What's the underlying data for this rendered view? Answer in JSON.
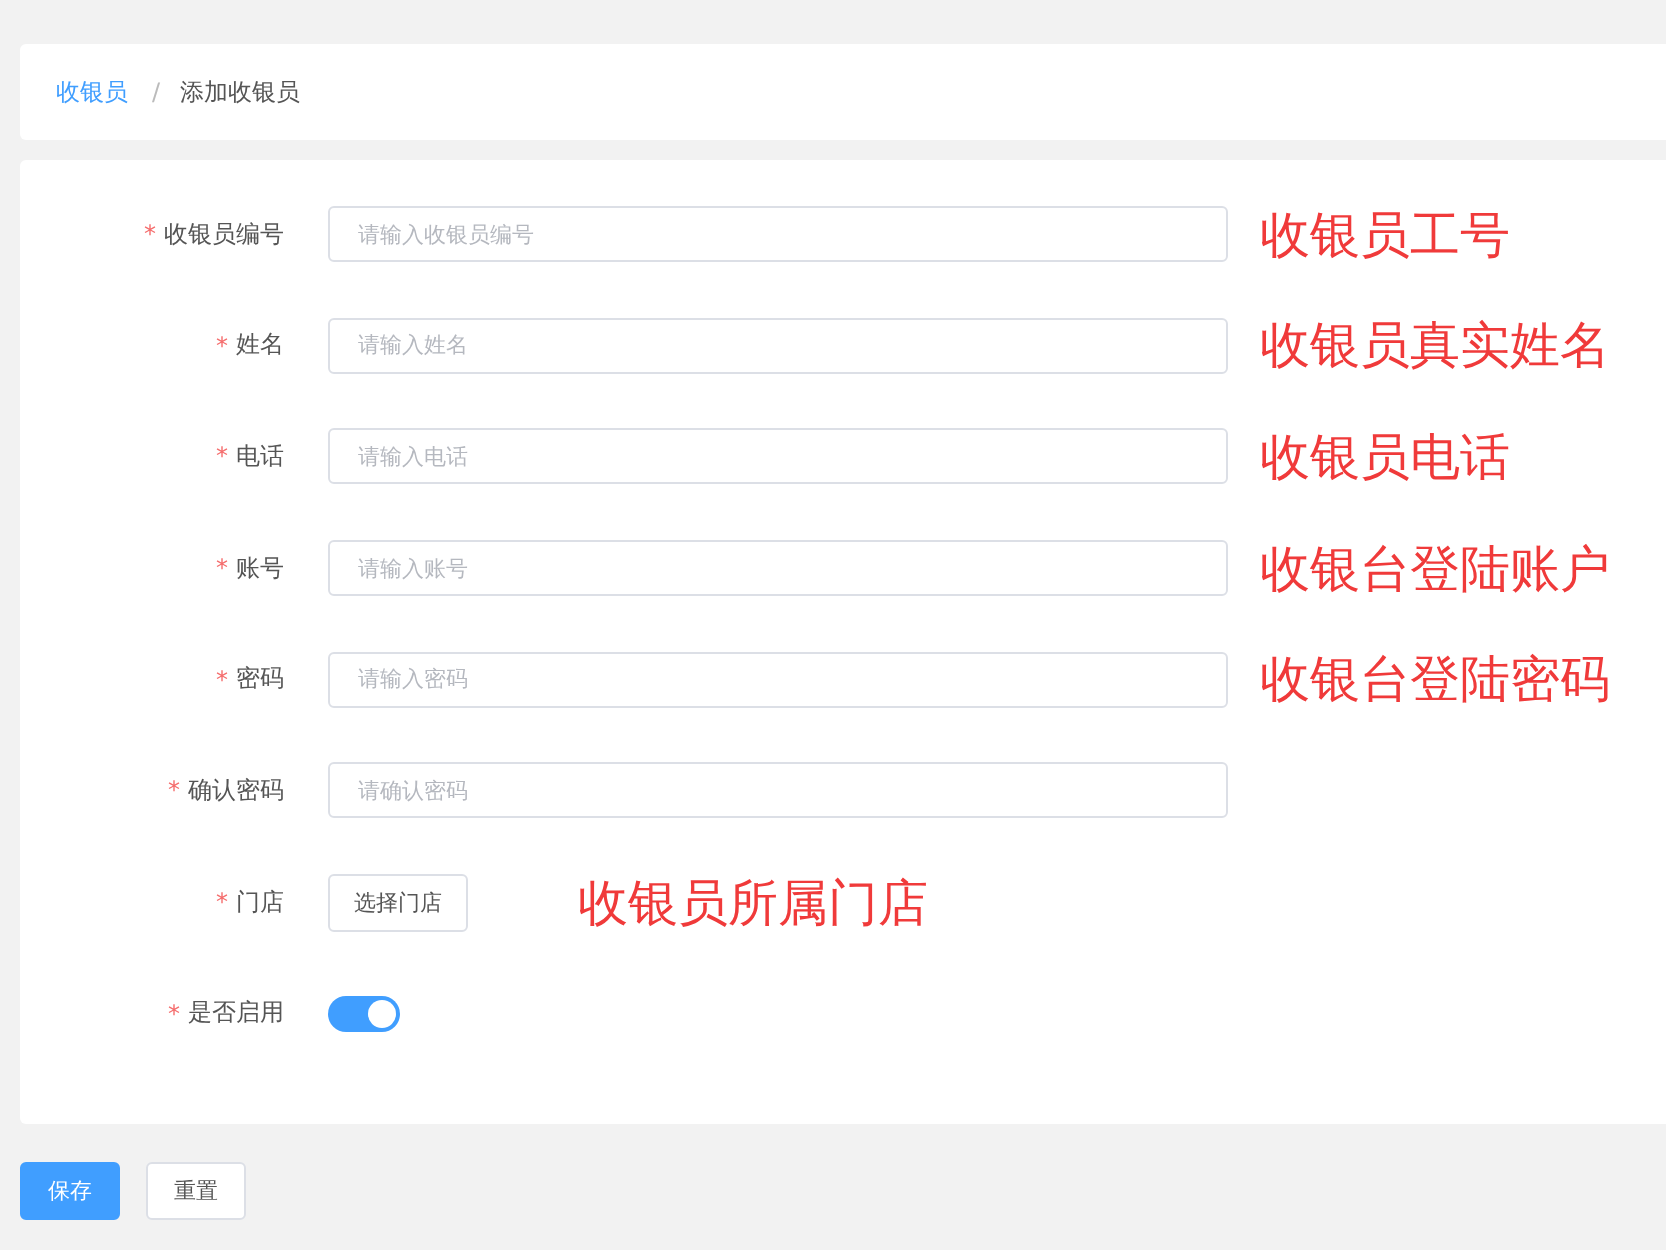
{
  "breadcrumb": [
    {
      "label": "收银员",
      "link": true
    },
    {
      "label": "添加收银员",
      "link": false
    }
  ],
  "separator": "/",
  "form": [
    {
      "kind": "input",
      "required_mark": "*",
      "label": "收银员编号",
      "placeholder": "请输入收银员编号",
      "note": "收银员工号"
    },
    {
      "kind": "input",
      "required_mark": "*",
      "label": "姓名",
      "placeholder": "请输入姓名",
      "note": "收银员真实姓名"
    },
    {
      "kind": "input",
      "required_mark": "*",
      "label": "电话",
      "placeholder": "请输入电话",
      "note": "收银员电话"
    },
    {
      "kind": "input",
      "required_mark": "*",
      "label": "账号",
      "placeholder": "请输入账号",
      "note": "收银台登陆账户"
    },
    {
      "kind": "input",
      "required_mark": "*",
      "label": "密码",
      "placeholder": "请输入密码",
      "note": "收银台登陆密码"
    },
    {
      "kind": "input",
      "required_mark": "*",
      "label": "确认密码",
      "placeholder": "请确认密码"
    },
    {
      "kind": "button",
      "required_mark": "*",
      "label": "门店",
      "button": "选择门店",
      "note": "收银员所属门店"
    },
    {
      "kind": "switch",
      "required_mark": "*",
      "label": "是否启用",
      "on": true
    }
  ],
  "actions": [
    {
      "label": "保存",
      "primary": true
    },
    {
      "label": "重置",
      "primary": false
    }
  ]
}
